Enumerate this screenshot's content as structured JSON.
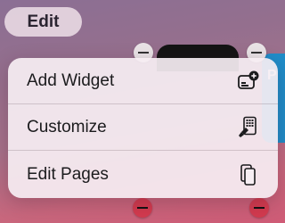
{
  "header": {
    "edit_label": "Edit"
  },
  "background": {
    "partial_label": "P"
  },
  "menu": {
    "items": [
      {
        "label": "Add Widget",
        "icon": "add-widget-icon"
      },
      {
        "label": "Customize",
        "icon": "customize-icon"
      },
      {
        "label": "Edit Pages",
        "icon": "edit-pages-icon"
      }
    ]
  },
  "colors": {
    "remove_badge_red": "#d33b4f",
    "remove_badge_gray": "#e9e3e6",
    "menu_background": "#f6eef3"
  }
}
